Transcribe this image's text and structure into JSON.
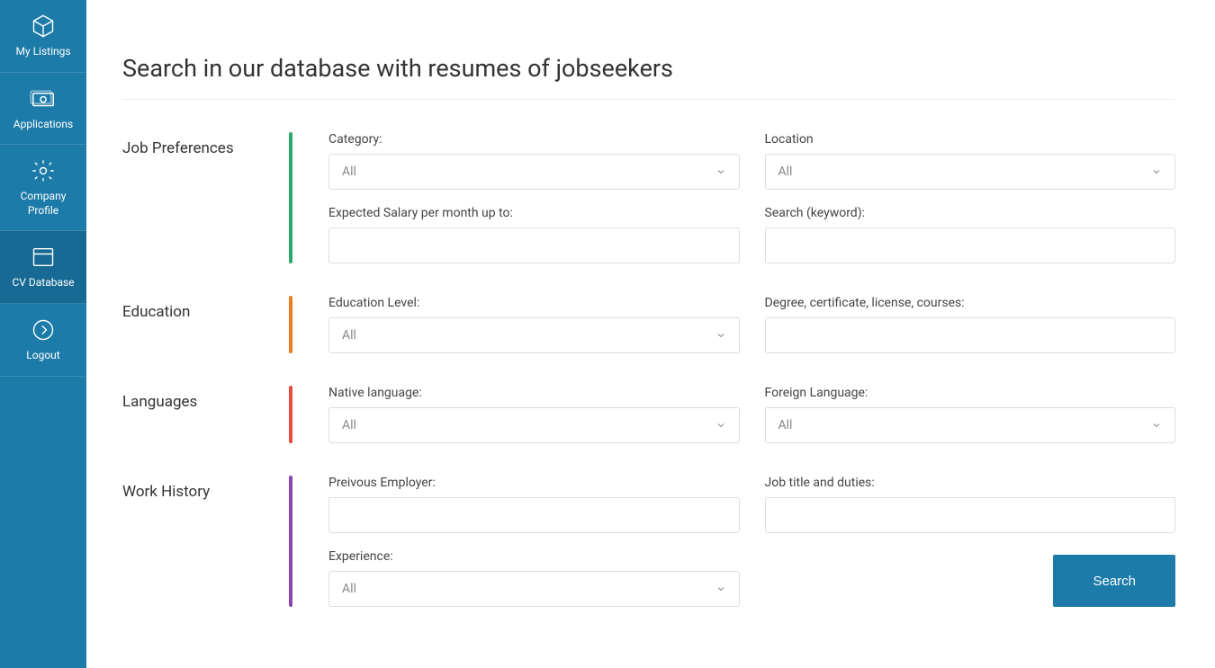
{
  "sidebar": {
    "items": [
      {
        "label": "My Listings"
      },
      {
        "label": "Applications"
      },
      {
        "label": "Company Profile"
      },
      {
        "label": "CV Database"
      },
      {
        "label": "Logout"
      }
    ]
  },
  "page": {
    "title": "Search in our database with resumes of jobseekers"
  },
  "sections": {
    "job_preferences": {
      "title": "Job Preferences",
      "category_label": "Category:",
      "category_value": "All",
      "location_label": "Location",
      "location_value": "All",
      "salary_label": "Expected Salary per month up to:",
      "salary_value": "",
      "keyword_label": "Search (keyword):",
      "keyword_value": ""
    },
    "education": {
      "title": "Education",
      "level_label": "Education Level:",
      "level_value": "All",
      "degree_label": "Degree, certificate, license, courses:",
      "degree_value": ""
    },
    "languages": {
      "title": "Languages",
      "native_label": "Native language:",
      "native_value": "All",
      "foreign_label": "Foreign Language:",
      "foreign_value": "All"
    },
    "work_history": {
      "title": "Work History",
      "employer_label": "Preivous Employer:",
      "employer_value": "",
      "jobtitle_label": "Job title and duties:",
      "jobtitle_value": "",
      "experience_label": "Experience:",
      "experience_value": "All"
    }
  },
  "buttons": {
    "search": "Search"
  }
}
